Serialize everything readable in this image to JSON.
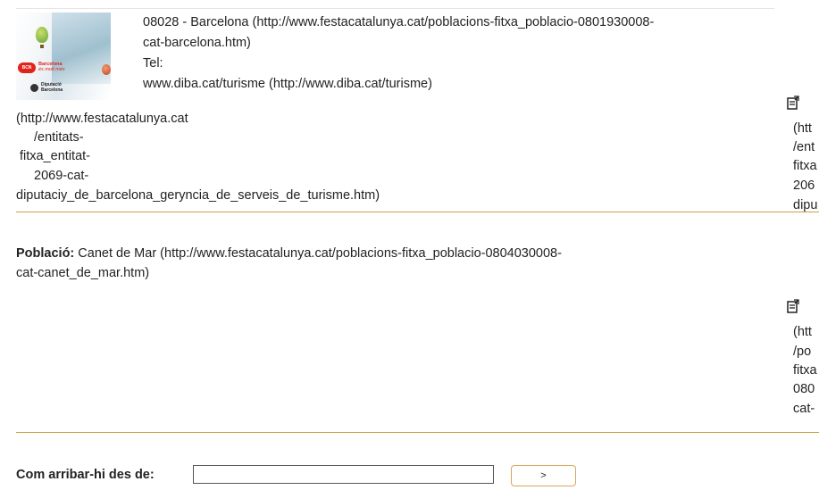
{
  "entity": {
    "address_line1": "08028 - Barcelona (http://www.festacatalunya.cat/poblacions-fitxa_poblacio-0801930008-",
    "address_line2": "cat-barcelona.htm)",
    "tel_label": "Tel:",
    "website": "www.diba.cat/turisme (http://www.diba.cat/turisme)",
    "link_lines": [
      "(http://www.festacatalunya.cat",
      "/entitats-",
      "fitxa_entitat-",
      "2069-cat-",
      "diputaciy_de_barcelona_geryncia_de_serveis_de_turisme.htm)"
    ],
    "logo": {
      "badge": "BCN",
      "brand_line1": "Barcelona",
      "brand_line2": "és molt més",
      "dipu_line1": "Diputació",
      "dipu_line2": "Barcelona"
    },
    "edge_link_fragments": [
      "(htt",
      "/ent",
      "fitxa",
      "206",
      "dipu"
    ]
  },
  "poblacio": {
    "label": "Població:",
    "text_line1": "Canet de Mar (http://www.festacatalunya.cat/poblacions-fitxa_poblacio-0804030008-",
    "text_line2": "cat-canet_de_mar.htm)",
    "edge_link_fragments": [
      "(htt",
      "/po",
      "fitxa",
      "080",
      "cat-"
    ]
  },
  "route": {
    "label": "Com arribar-hi des de:",
    "input_value": "",
    "submit_label": ">"
  },
  "colors": {
    "divider": "#c8a04a",
    "button_border": "#d4a85a",
    "text": "#222222"
  },
  "icons": [
    "share-icon",
    "share-icon"
  ]
}
